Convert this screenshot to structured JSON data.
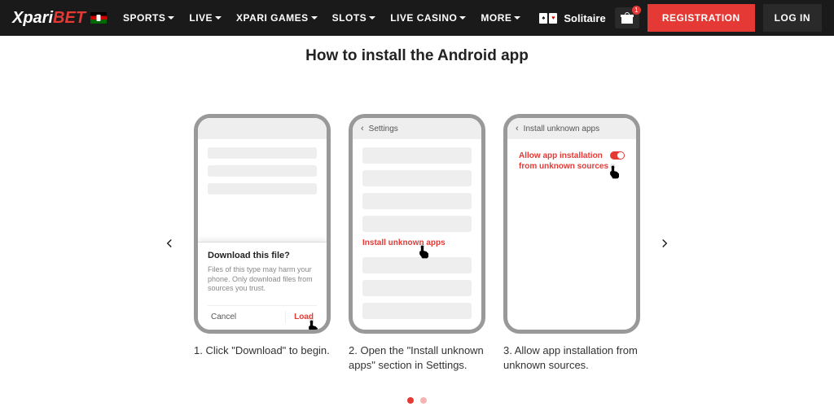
{
  "header": {
    "logo": {
      "part1": "Xpari",
      "part2": "BET"
    },
    "nav": [
      {
        "label": "SPORTS",
        "dropdown": true
      },
      {
        "label": "LIVE",
        "dropdown": true
      },
      {
        "label": "XPARI GAMES",
        "dropdown": true
      },
      {
        "label": "SLOTS",
        "dropdown": true
      },
      {
        "label": "LIVE CASINO",
        "dropdown": true
      },
      {
        "label": "MORE",
        "dropdown": true
      }
    ],
    "solitaire": "Solitaire",
    "gift_badge": "1",
    "registration": "REGISTRATION",
    "login": "LOG IN"
  },
  "title": "How to install the Android app",
  "steps": [
    {
      "num": "1.",
      "caption": "Click \"Download\" to begin.",
      "modal_title": "Download this file?",
      "modal_text": "Files of this type may harm your phone. Only download files from sources you trust.",
      "cancel": "Cancel",
      "load": "Load"
    },
    {
      "num": "2.",
      "caption": "Open the \"Install unknown apps\" section in Settings.",
      "header_label": "Settings",
      "link": "Install unknown apps"
    },
    {
      "num": "3.",
      "caption": "Allow app installation from unknown sources.",
      "header_label": "Install unknown apps",
      "allow_text": "Allow app installation from unknown sources"
    }
  ]
}
